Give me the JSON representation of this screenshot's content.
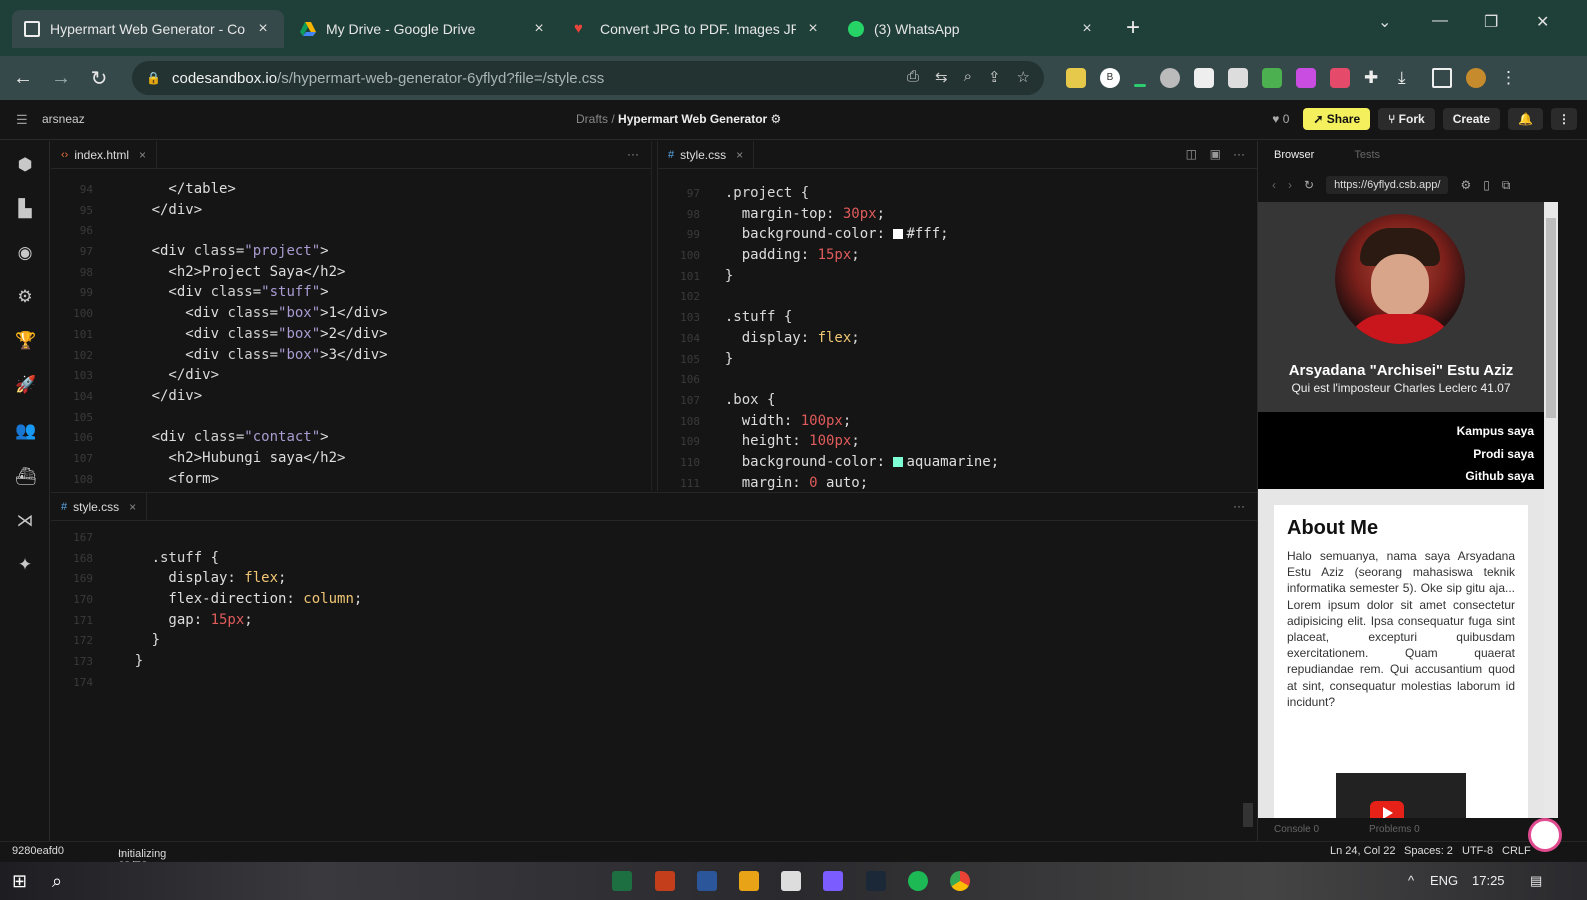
{
  "browser": {
    "tabs": [
      {
        "title": "Hypermart Web Generator - Co",
        "active": true
      },
      {
        "title": "My Drive - Google Drive",
        "active": false
      },
      {
        "title": "Convert JPG to PDF. Images JPG",
        "active": false
      },
      {
        "title": "(3) WhatsApp",
        "active": false
      }
    ],
    "new_tab": "+",
    "close_glyph": "×",
    "url_host": "codesandbox.io",
    "url_path": "/s/hypermart-web-generator-6yflyd?file=/style.css",
    "profile_letter": "B"
  },
  "header": {
    "user": "arsneaz",
    "breadcrumb_folder": "Drafts",
    "breadcrumb_sep": "/",
    "sandbox_title": "Hypermart Web Generator",
    "likes": "0",
    "share": "Share",
    "fork": "Fork",
    "create": "Create"
  },
  "editor_left": {
    "tab": "index.html",
    "lines": [
      {
        "n": "94",
        "html": "<span class='p'>      &lt;/table&gt;</span>"
      },
      {
        "n": "95",
        "html": "<span class='p'>    &lt;/div&gt;</span>"
      },
      {
        "n": "96",
        "html": ""
      },
      {
        "n": "97",
        "html": "<span class='p'>    &lt;div </span><span class='a'>class=</span><span class='s'>\"project\"</span><span class='p'>&gt;</span>"
      },
      {
        "n": "98",
        "html": "<span class='p'>      &lt;h2&gt;Project Saya&lt;/h2&gt;</span>"
      },
      {
        "n": "99",
        "html": "<span class='p'>      &lt;div </span><span class='a'>class=</span><span class='s'>\"stuff\"</span><span class='p'>&gt;</span>"
      },
      {
        "n": "100",
        "html": "<span class='p'>        &lt;div </span><span class='a'>class=</span><span class='s'>\"box\"</span><span class='p'>&gt;1&lt;/div&gt;</span>"
      },
      {
        "n": "101",
        "html": "<span class='p'>        &lt;div </span><span class='a'>class=</span><span class='s'>\"box\"</span><span class='p'>&gt;2&lt;/div&gt;</span>"
      },
      {
        "n": "102",
        "html": "<span class='p'>        &lt;div </span><span class='a'>class=</span><span class='s'>\"box\"</span><span class='p'>&gt;3&lt;/div&gt;</span>"
      },
      {
        "n": "103",
        "html": "<span class='p'>      &lt;/div&gt;</span>"
      },
      {
        "n": "104",
        "html": "<span class='p'>    &lt;/div&gt;</span>"
      },
      {
        "n": "105",
        "html": ""
      },
      {
        "n": "106",
        "html": "<span class='p'>    &lt;div </span><span class='a'>class=</span><span class='s'>\"contact\"</span><span class='p'>&gt;</span>"
      },
      {
        "n": "107",
        "html": "<span class='p'>      &lt;h2&gt;Hubungi saya&lt;/h2&gt;</span>"
      },
      {
        "n": "108",
        "html": "<span class='p'>      &lt;form&gt;</span>"
      }
    ]
  },
  "editor_right": {
    "tab": "style.css",
    "lines": [
      {
        "n": "97",
        "html": "<span class='sel'>.project </span><span class='p'>{</span>"
      },
      {
        "n": "98",
        "html": "<span class='p'>  margin-top: </span><span class='num'>30px</span><span class='p'>;</span>"
      },
      {
        "n": "99",
        "html": "<span class='p'>  background-color: </span><span class='swatch' style='background:#fff'></span><span class='p'>#fff;</span>"
      },
      {
        "n": "100",
        "html": "<span class='p'>  padding: </span><span class='num'>15px</span><span class='p'>;</span>"
      },
      {
        "n": "101",
        "html": "<span class='p'>}</span>"
      },
      {
        "n": "102",
        "html": ""
      },
      {
        "n": "103",
        "html": "<span class='sel'>.stuff </span><span class='p'>{</span>"
      },
      {
        "n": "104",
        "html": "<span class='p'>  display: </span><span class='kw'>flex</span><span class='p'>;</span>"
      },
      {
        "n": "105",
        "html": "<span class='p'>}</span>"
      },
      {
        "n": "106",
        "html": ""
      },
      {
        "n": "107",
        "html": "<span class='sel'>.box </span><span class='p'>{</span>"
      },
      {
        "n": "108",
        "html": "<span class='p'>  width: </span><span class='num'>100px</span><span class='p'>;</span>"
      },
      {
        "n": "109",
        "html": "<span class='p'>  height: </span><span class='num'>100px</span><span class='p'>;</span>"
      },
      {
        "n": "110",
        "html": "<span class='p'>  background-color: </span><span class='swatch' style='background:#7fffd4'></span><span class='p'>aquamarine;</span>"
      },
      {
        "n": "111",
        "html": "<span class='p'>  margin: </span><span class='num'>0</span><span class='p'> auto;</span>"
      }
    ]
  },
  "editor_bottom": {
    "tab": "style.css",
    "lines": [
      {
        "n": "167",
        "html": ""
      },
      {
        "n": "168",
        "html": "<span class='sel'>    .stuff </span><span class='p'>{</span>"
      },
      {
        "n": "169",
        "html": "<span class='p'>      display: </span><span class='kw'>flex</span><span class='p'>;</span>"
      },
      {
        "n": "170",
        "html": "<span class='p'>      flex-direction: </span><span class='kw'>column</span><span class='p'>;</span>"
      },
      {
        "n": "171",
        "html": "<span class='p'>      gap: </span><span class='num'>15px</span><span class='p'>;</span>"
      },
      {
        "n": "172",
        "html": "<span class='p'>    }</span>"
      },
      {
        "n": "173",
        "html": "<span class='p'>  }</span>"
      },
      {
        "n": "174",
        "html": ""
      }
    ]
  },
  "preview": {
    "tab_browser": "Browser",
    "tab_tests": "Tests",
    "url": "https://6yflyd.csb.app/",
    "name": "Arsyadana \"Archisei\" Estu Aziz",
    "subtitle": "Qui est l'imposteur Charles Leclerc 41.07",
    "nav": [
      "Kampus saya",
      "Prodi saya",
      "Github saya"
    ],
    "about_title": "About Me",
    "about_text": "Halo semuanya, nama saya Arsyadana Estu Aziz (seorang mahasiswa teknik informatika semester 5). Oke sip gitu aja... Lorem ipsum dolor sit amet consectetur adipisicing elit. Ipsa consequatur fuga sint placeat, excepturi quibusdam exercitationem. Quam quaerat repudiandae rem. Qui accusantium quod at sint, consequatur molestias laborum id incidunt?",
    "console": "Console",
    "problems": "Problems",
    "console_count": "0",
    "problems_count": "0"
  },
  "status": {
    "commit": "9280eafd0",
    "message": "Initializing JS/TS language features",
    "position": "Ln 24, Col 22",
    "spaces": "Spaces: 2",
    "encoding": "UTF-8",
    "eol": "CRLF"
  },
  "taskbar": {
    "lang": "ENG",
    "time": "17:25"
  }
}
